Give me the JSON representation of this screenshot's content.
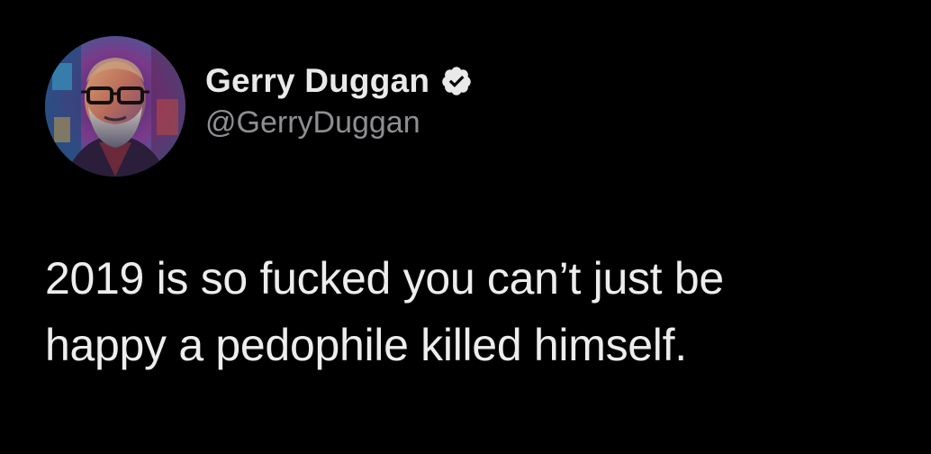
{
  "author": {
    "display_name": "Gerry Duggan",
    "handle": "@GerryDuggan",
    "verified": true,
    "avatar_icon": "profile-photo-man-glasses-beard-stylized"
  },
  "tweet": {
    "lines": [
      "2019 is so fucked you can’t just be",
      "happy a pedophile killed himself."
    ]
  },
  "colors": {
    "background": "#000000",
    "name": "#e9e9e9",
    "handle": "#8e8e93",
    "text": "#ededed",
    "verified_badge": "#e9e9e9"
  }
}
